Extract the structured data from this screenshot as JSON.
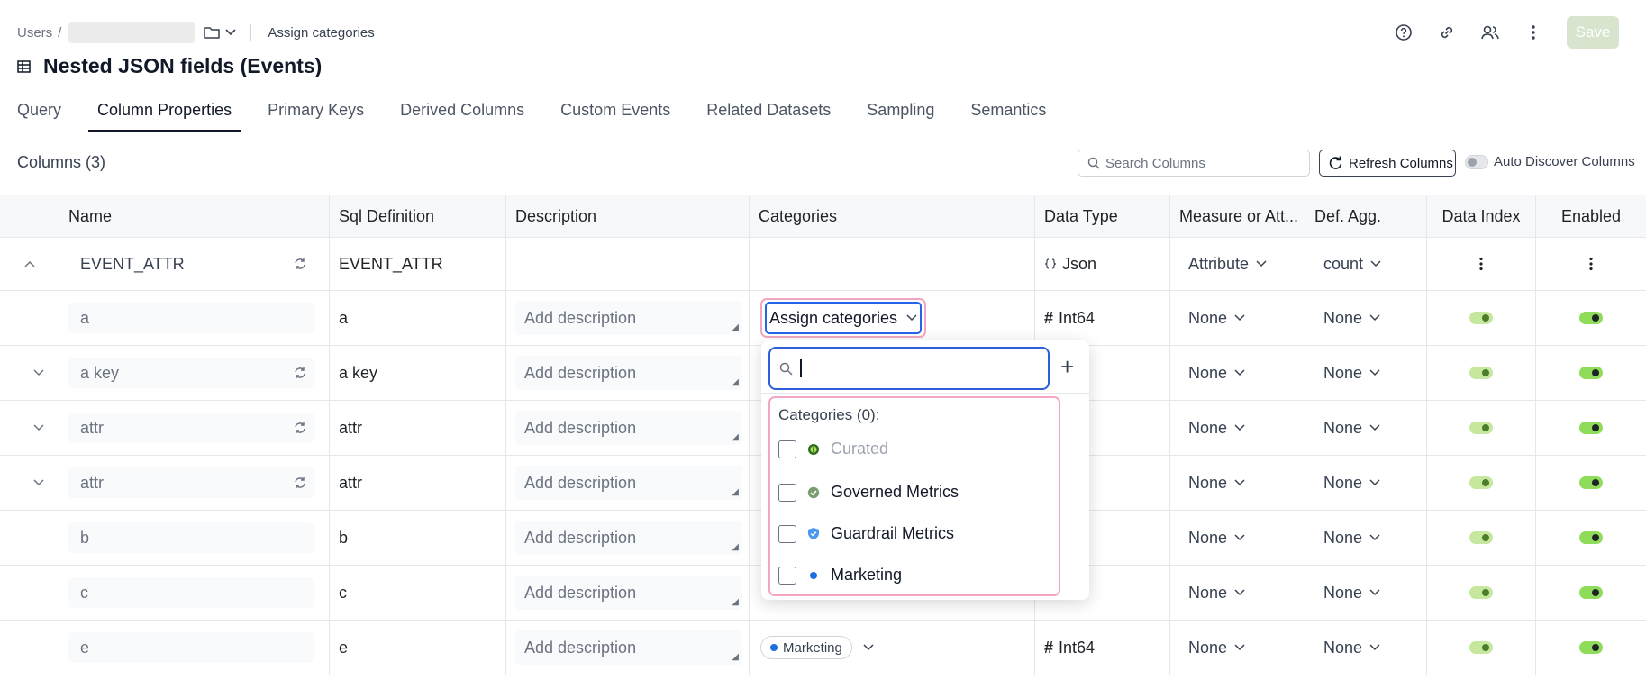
{
  "breadcrumb": {
    "root": "Users",
    "separator": "/",
    "current": "Assign categories"
  },
  "page": {
    "title": "Nested JSON fields (Events)"
  },
  "toolbar": {
    "save_label": "Save"
  },
  "tabs": [
    {
      "label": "Query",
      "active": false
    },
    {
      "label": "Column Properties",
      "active": true
    },
    {
      "label": "Primary Keys",
      "active": false
    },
    {
      "label": "Derived Columns",
      "active": false
    },
    {
      "label": "Custom Events",
      "active": false
    },
    {
      "label": "Related Datasets",
      "active": false
    },
    {
      "label": "Sampling",
      "active": false
    },
    {
      "label": "Semantics",
      "active": false
    }
  ],
  "columns_section": {
    "title": "Columns (3)",
    "search_placeholder": "Search Columns",
    "refresh_label": "Refresh Columns",
    "auto_discover_label": "Auto Discover Columns"
  },
  "table": {
    "headers": [
      "Name",
      "Sql Definition",
      "Description",
      "Categories",
      "Data Type",
      "Measure or Att...",
      "Def. Agg.",
      "Data Index",
      "Enabled"
    ],
    "description_placeholder": "Add description",
    "rows": [
      {
        "name": "EVENT_ATTR",
        "sql": "EVENT_ATTR",
        "data_type": "Json",
        "measure": "Attribute",
        "agg": "count"
      },
      {
        "name": "a",
        "sql": "a",
        "data_type": "Int64",
        "measure": "None",
        "agg": "None",
        "categories_button": "Assign categories"
      },
      {
        "name": "a key",
        "sql": "a key",
        "data_type": "...n",
        "measure": "None",
        "agg": "None"
      },
      {
        "name": "attr",
        "sql": "attr",
        "data_type": "...n",
        "measure": "None",
        "agg": "None"
      },
      {
        "name": "attr",
        "sql": "attr",
        "data_type": "...n",
        "measure": "None",
        "agg": "None"
      },
      {
        "name": "b",
        "sql": "b",
        "data_type": "...4",
        "measure": "None",
        "agg": "None"
      },
      {
        "name": "c",
        "sql": "c",
        "data_type": "...4",
        "measure": "None",
        "agg": "None"
      },
      {
        "name": "e",
        "sql": "e",
        "data_type": "Int64",
        "measure": "None",
        "agg": "None",
        "category_tag": "Marketing"
      }
    ]
  },
  "category_popover": {
    "count_label": "Categories (0):",
    "items": [
      {
        "label": "Curated",
        "icon": "curated-icon",
        "disabled": true
      },
      {
        "label": "Governed Metrics",
        "icon": "check-badge-icon",
        "disabled": false
      },
      {
        "label": "Guardrail Metrics",
        "icon": "shield-check-icon",
        "disabled": false
      },
      {
        "label": "Marketing",
        "icon": "blue-dot-icon",
        "disabled": false
      }
    ]
  },
  "colors": {
    "accent_blue": "#2563eb",
    "highlight_pink": "#f3a6c4",
    "toggle_green": "#8fdc5a",
    "save_disabled": "#d9e4cf"
  }
}
